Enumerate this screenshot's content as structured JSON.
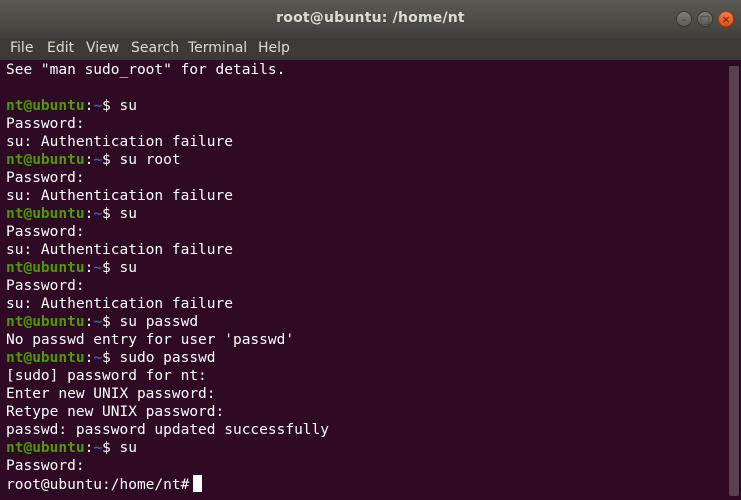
{
  "window": {
    "title": "root@ubuntu: /home/nt",
    "buttons": {
      "minimize": "–",
      "maximize": "□",
      "close": "×"
    }
  },
  "menu": [
    "File",
    "Edit",
    "View",
    "Search",
    "Terminal",
    "Help"
  ],
  "terminal": {
    "lines": [
      {
        "text": "See \"man sudo_root\" for details."
      },
      {
        "text": ""
      },
      {
        "user": "nt@ubuntu",
        "path": "~",
        "cmd": " su"
      },
      {
        "text": "Password:"
      },
      {
        "text": "su: Authentication failure"
      },
      {
        "user": "nt@ubuntu",
        "path": "~",
        "cmd": " su root"
      },
      {
        "text": "Password:"
      },
      {
        "text": "su: Authentication failure"
      },
      {
        "user": "nt@ubuntu",
        "path": "~",
        "cmd": " su"
      },
      {
        "text": "Password:"
      },
      {
        "text": "su: Authentication failure"
      },
      {
        "user": "nt@ubuntu",
        "path": "~",
        "cmd": " su"
      },
      {
        "text": "Password:"
      },
      {
        "text": "su: Authentication failure"
      },
      {
        "user": "nt@ubuntu",
        "path": "~",
        "cmd": " su passwd"
      },
      {
        "text": "No passwd entry for user 'passwd'"
      },
      {
        "user": "nt@ubuntu",
        "path": "~",
        "cmd": " sudo passwd"
      },
      {
        "text": "[sudo] password for nt:"
      },
      {
        "text": "Enter new UNIX password:"
      },
      {
        "text": "Retype new UNIX password:"
      },
      {
        "text": "passwd: password updated successfully"
      },
      {
        "user": "nt@ubuntu",
        "path": "~",
        "cmd": " su"
      },
      {
        "text": "Password:"
      },
      {
        "text": "root@ubuntu:/home/nt#",
        "cursor": true
      }
    ]
  },
  "colors": {
    "terminal_bg": "#2f0a24",
    "prompt_user": "#4e9a06",
    "prompt_path": "#3465a4",
    "close_button": "#e95420"
  }
}
